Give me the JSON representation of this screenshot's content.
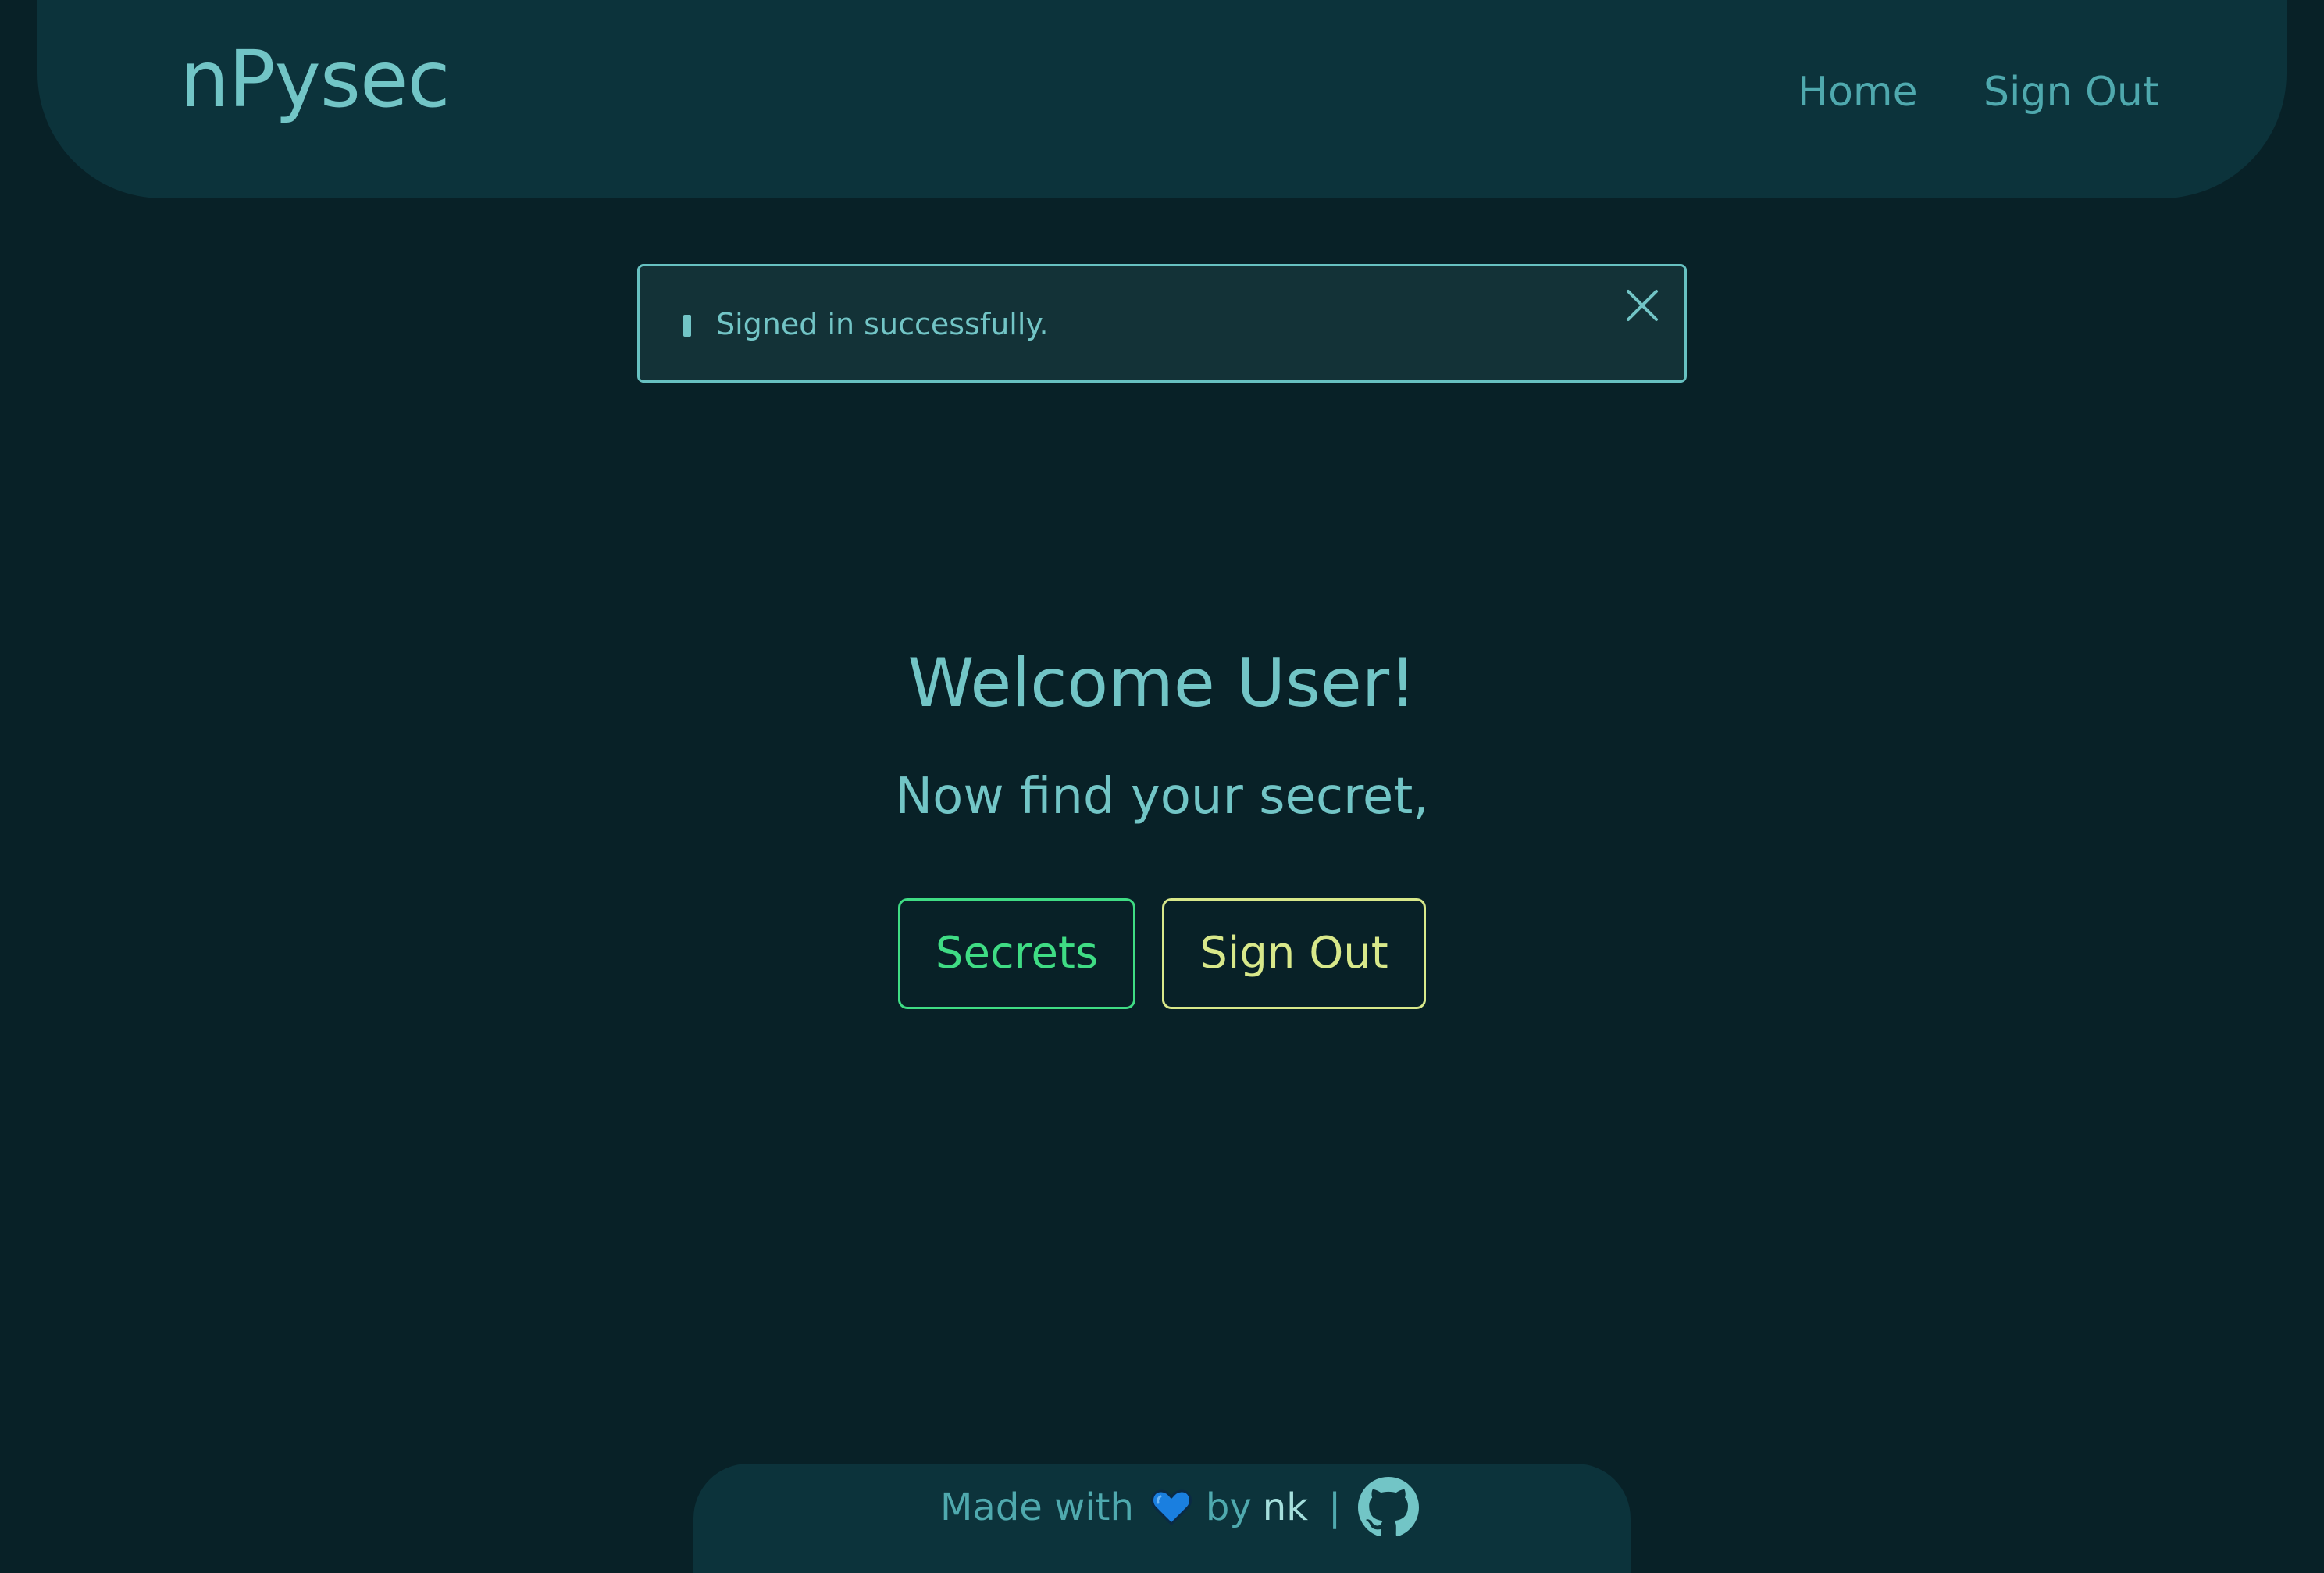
{
  "navbar": {
    "brand": "nPysec",
    "links": [
      {
        "label": "Home"
      },
      {
        "label": "Sign Out"
      }
    ]
  },
  "flash": {
    "message": "Signed in successfully.",
    "close_icon": "close-icon"
  },
  "main": {
    "welcome": "Welcome User!",
    "subtitle": "Now find your secret,",
    "buttons": {
      "secrets": "Secrets",
      "sign_out": "Sign Out"
    }
  },
  "footer": {
    "made_with": "Made with",
    "heart_icon": "blue-heart-icon",
    "by": "by",
    "author": "nk",
    "separator": "|",
    "github_icon": "github-icon"
  },
  "colors": {
    "background": "#082127",
    "panel": "#0c333b",
    "accent": "#72c5c6",
    "secrets_button": "#3fdc84",
    "sign_out_button": "#d8e88a",
    "heart": "#1a7fe0"
  }
}
